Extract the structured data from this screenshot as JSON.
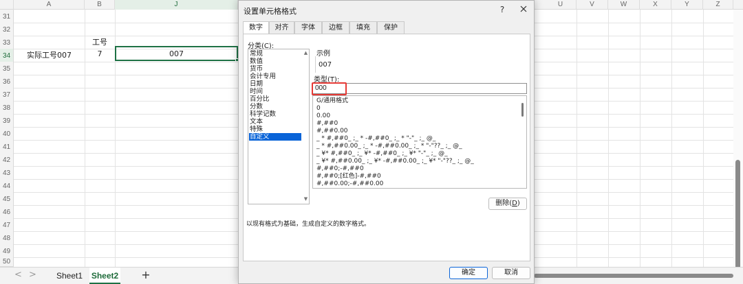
{
  "sheet": {
    "columns": {
      "A": "A",
      "B": "B",
      "J": "J",
      "U": "U",
      "V": "V",
      "W": "W",
      "X": "X",
      "Y": "Y",
      "Z": "Z"
    },
    "rows": [
      "31",
      "32",
      "33",
      "34",
      "35",
      "36",
      "37",
      "38",
      "39",
      "40",
      "41",
      "42",
      "43",
      "44",
      "45",
      "46",
      "47",
      "48",
      "49",
      "50"
    ],
    "cells": {
      "B33": "工号",
      "A34": "实际工号007",
      "B34": "7",
      "J34": "007"
    },
    "active_row": "34",
    "tabs": {
      "sheet1": "Sheet1",
      "sheet2": "Sheet2",
      "add": "+"
    },
    "nav": {
      "prev": "<",
      "next": ">"
    },
    "colors": {
      "accent": "#1e7145",
      "selection": "#0a64d8",
      "highlight": "#e53935"
    }
  },
  "dialog": {
    "title": "设置单元格格式",
    "help": "?",
    "tabs": [
      "数字",
      "对齐",
      "字体",
      "边框",
      "填充",
      "保护"
    ],
    "category_label_pre": "分类(",
    "category_label_key": "C",
    "category_label_post": "):",
    "categories": [
      "常规",
      "数值",
      "货币",
      "会计专用",
      "日期",
      "时间",
      "百分比",
      "分数",
      "科学记数",
      "文本",
      "特殊",
      "自定义"
    ],
    "selected_category": "自定义",
    "sample_label": "示例",
    "sample_value": "007",
    "type_label_pre": "类型(",
    "type_label_key": "T",
    "type_label_post": "):",
    "type_value": "000",
    "formats": [
      "G/通用格式",
      "0",
      "0.00",
      "#,##0",
      "#,##0.00",
      "_ * #,##0_ ;_ * -#,##0_ ;_ * \"-\"_ ;_ @_",
      "_ * #,##0.00_ ;_ * -#,##0.00_ ;_ * \"-\"??_ ;_ @_",
      "_ ¥* #,##0_ ;_ ¥* -#,##0_ ;_ ¥* \"-\"_ ;_ @_",
      "_ ¥* #,##0.00_ ;_ ¥* -#,##0.00_ ;_ ¥* \"-\"??_ ;_ @_",
      "#,##0;-#,##0",
      "#,##0;[红色]-#,##0",
      "#,##0.00;-#,##0.00"
    ],
    "delete_button_pre": "删除(",
    "delete_button_key": "D",
    "delete_button_post": ")",
    "hint": "以现有格式为基础，生成自定义的数字格式。",
    "ok_button": "确定",
    "cancel_button": "取消"
  }
}
